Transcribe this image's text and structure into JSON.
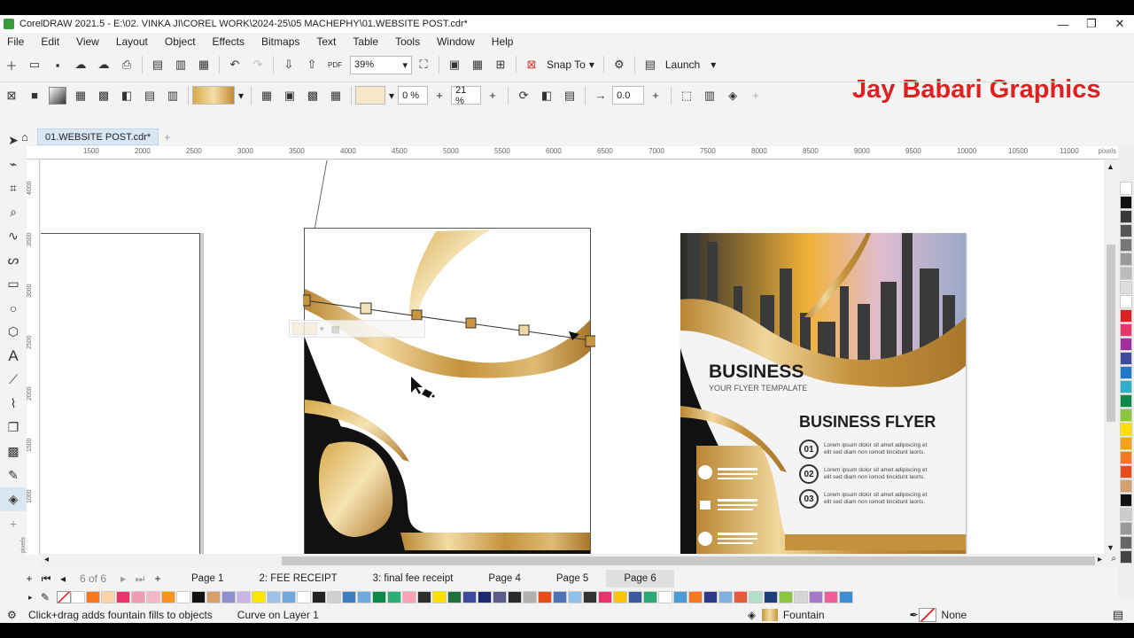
{
  "window": {
    "title": "CorelDRAW 2021.5 - E:\\02. VINKA JI\\COREL WORK\\2024-25\\05 MACHEPHY\\01.WEBSITE POST.cdr*",
    "minimize": "—",
    "maximize": "❐",
    "close": "✕"
  },
  "menu": [
    "File",
    "Edit",
    "View",
    "Layout",
    "Object",
    "Effects",
    "Bitmaps",
    "Text",
    "Table",
    "Tools",
    "Window",
    "Help"
  ],
  "toolbar1": {
    "zoom": "39%",
    "snap_label": "Snap To",
    "launch_label": "Launch"
  },
  "toolbar2": {
    "mid_point": "0 %",
    "edge_pad": "21 %",
    "nudge": "0.0"
  },
  "watermark": "Jay Babari Graphics",
  "doc_tab": "01.WEBSITE POST.cdr*",
  "ruler": {
    "ticks": [
      "1500",
      "2000",
      "2500",
      "3000",
      "3500",
      "4000",
      "4500",
      "5000",
      "5500",
      "6000",
      "6500",
      "7000",
      "7500",
      "8000",
      "8500",
      "9000",
      "9500",
      "10000",
      "10500",
      "11000"
    ],
    "units": "pixels",
    "vticks": [
      "4000",
      "3500",
      "3000",
      "2500",
      "2000",
      "1500",
      "1000"
    ],
    "vunits": "pixels"
  },
  "page_nav": {
    "counter": "6 of 6",
    "pages": [
      "Page 1",
      "2: FEE RECEIPT",
      "3: final fee receipt",
      "Page 4",
      "Page 5",
      "Page 6"
    ],
    "active_index": 5
  },
  "flyer": {
    "heading": "BUSINESS",
    "subheading": "YOUR FLYER TEMPALATE",
    "title": "BUSINESS FLYER",
    "items": [
      {
        "num": "01",
        "text1": "Lorem ipsum dolor sit amet adipiscing et",
        "text2": "elit sed diam non iomod tincidunt laorts."
      },
      {
        "num": "02",
        "text1": "Lorem ipsum dolor sit amet adipiscing et",
        "text2": "elit sed diam non iomod tincidunt laorts."
      },
      {
        "num": "03",
        "text1": "Lorem ipsum dolor sit amet adipiscing et",
        "text2": "elit sed diam non iomod tincidunt laorts."
      }
    ]
  },
  "status": {
    "hint": "Click+drag adds fountain fills to objects",
    "selection": "Curve on Layer 1",
    "fill_label": "Fountain",
    "outline_label": "None"
  },
  "colors": {
    "accent_gold": "#c8963e",
    "light_gold": "#f2dca4",
    "watermark_red": "#e02020",
    "flyer_dark": "#111111"
  }
}
